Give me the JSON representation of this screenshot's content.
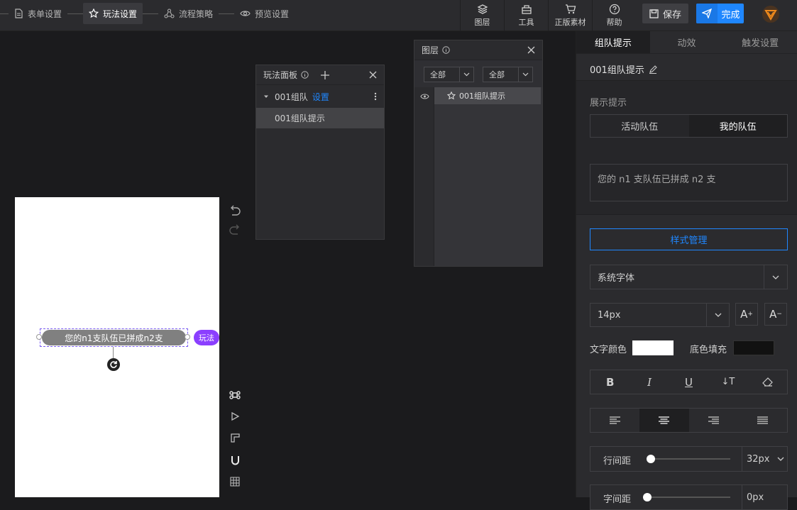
{
  "steps": [
    {
      "label": "表单设置",
      "icon": "document-icon"
    },
    {
      "label": "玩法设置",
      "icon": "star-icon"
    },
    {
      "label": "流程策略",
      "icon": "flow-icon"
    },
    {
      "label": "预览设置",
      "icon": "eye-icon"
    }
  ],
  "tools": [
    {
      "label": "图层",
      "icon": "layers-icon"
    },
    {
      "label": "工具",
      "icon": "toolbox-icon"
    },
    {
      "label": "正版素材",
      "icon": "cart-icon"
    },
    {
      "label": "帮助",
      "icon": "help-icon"
    }
  ],
  "save_label": "保存",
  "done_label": "完成",
  "canvas": {
    "tip_text": "您的n1支队伍已拼成n2支",
    "badge": "玩法"
  },
  "play_panel": {
    "title": "玩法面板",
    "group": "001组队",
    "group_link": "设置",
    "child": "001组队提示"
  },
  "layer_panel": {
    "title": "图层",
    "filter1": "全部",
    "filter2": "全部",
    "item": "001组队提示"
  },
  "right_panel": {
    "tabs": [
      "组队提示",
      "动效",
      "触发设置"
    ],
    "element_name": "001组队提示",
    "section_label": "展示提示",
    "seg": [
      "活动队伍",
      "我的队伍"
    ],
    "text_value": "您的 n1 支队伍已拼成 n2 支",
    "style_btn": "样式管理",
    "font_family": "系统字体",
    "font_size": "14px",
    "text_color_label": "文字颜色",
    "bg_fill_label": "底色填充",
    "text_color": "#ffffff",
    "bg_color": "#111111",
    "line_height_label": "行间距",
    "line_height_value": "32px",
    "letter_spacing_label": "字间距",
    "letter_spacing_value": "0px",
    "accent": "#1f87ff"
  }
}
